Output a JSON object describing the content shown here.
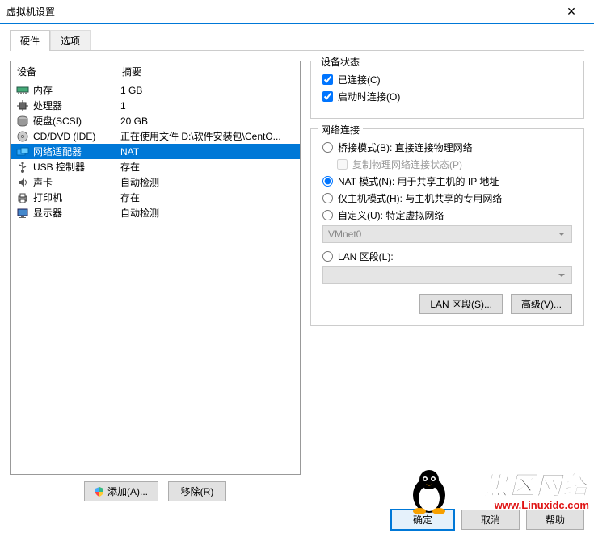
{
  "window": {
    "title": "虚拟机设置"
  },
  "tabs": {
    "hardware": "硬件",
    "options": "选项"
  },
  "deviceList": {
    "headerDevice": "设备",
    "headerSummary": "摘要",
    "rows": [
      {
        "name": "内存",
        "summary": "1 GB",
        "icon": "memory"
      },
      {
        "name": "处理器",
        "summary": "1",
        "icon": "cpu"
      },
      {
        "name": "硬盘(SCSI)",
        "summary": "20 GB",
        "icon": "disk"
      },
      {
        "name": "CD/DVD (IDE)",
        "summary": "正在使用文件 D:\\软件安装包\\CentO...",
        "icon": "cd"
      },
      {
        "name": "网络适配器",
        "summary": "NAT",
        "icon": "net",
        "selected": true
      },
      {
        "name": "USB 控制器",
        "summary": "存在",
        "icon": "usb"
      },
      {
        "name": "声卡",
        "summary": "自动检测",
        "icon": "sound"
      },
      {
        "name": "打印机",
        "summary": "存在",
        "icon": "printer"
      },
      {
        "name": "显示器",
        "summary": "自动检测",
        "icon": "display"
      }
    ]
  },
  "leftButtons": {
    "add": "添加(A)...",
    "remove": "移除(R)"
  },
  "deviceStatus": {
    "groupTitle": "设备状态",
    "connected": "已连接(C)",
    "connectAtPowerOn": "启动时连接(O)"
  },
  "netConn": {
    "groupTitle": "网络连接",
    "bridged": "桥接模式(B): 直接连接物理网络",
    "replicate": "复制物理网络连接状态(P)",
    "nat": "NAT 模式(N): 用于共享主机的 IP 地址",
    "hostOnly": "仅主机模式(H): 与主机共享的专用网络",
    "custom": "自定义(U): 特定虚拟网络",
    "vmnet": "VMnet0",
    "lanSegment": "LAN 区段(L):",
    "lanButton": "LAN 区段(S)...",
    "advanced": "高级(V)..."
  },
  "footer": {
    "ok": "确定",
    "cancel": "取消",
    "help": "帮助"
  },
  "watermark": {
    "big": "黑区网络",
    "small": "www.Linuxidc.com"
  }
}
